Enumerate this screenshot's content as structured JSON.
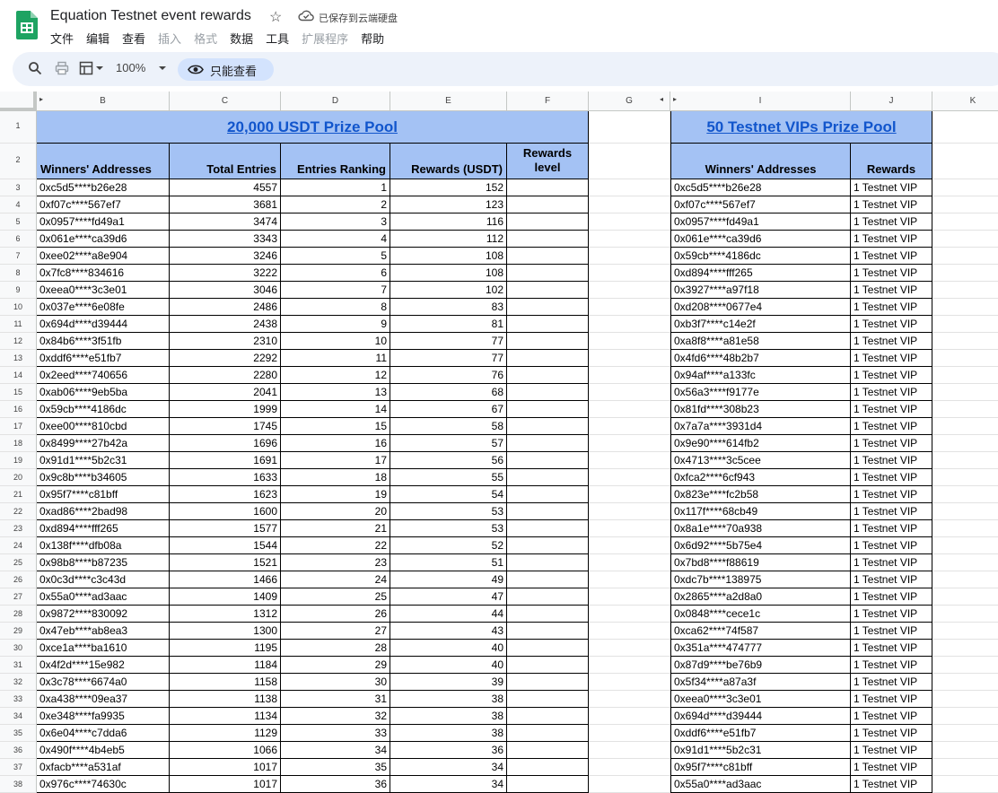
{
  "app": {
    "doc_title": "Equation Testnet event rewards",
    "saved_status": "已保存到云端硬盘",
    "menu": [
      "文件",
      "编辑",
      "查看",
      "插入",
      "格式",
      "数据",
      "工具",
      "扩展程序",
      "帮助"
    ],
    "menu_disabled": [
      false,
      false,
      false,
      true,
      true,
      false,
      false,
      true,
      false
    ],
    "zoom": "100%",
    "view_only_label": "只能查看",
    "accent_color": "#1ea362",
    "header_fill_color": "#a4c2f4",
    "link_color": "#1155cc"
  },
  "columns": [
    "B",
    "C",
    "D",
    "E",
    "F",
    "G",
    "I",
    "J",
    "K"
  ],
  "rows": [
    "1",
    "2",
    "3",
    "4",
    "5",
    "6",
    "7",
    "8",
    "9",
    "10",
    "11",
    "12",
    "13",
    "14",
    "15",
    "16",
    "17",
    "18",
    "19",
    "20",
    "21",
    "22",
    "23",
    "24",
    "25",
    "26",
    "27",
    "28",
    "29",
    "30",
    "31",
    "32",
    "33",
    "34",
    "35",
    "36",
    "37",
    "38"
  ],
  "table1": {
    "title": "20,000 USDT Prize Pool",
    "headers": [
      "Winners' Addresses",
      "Total Entries",
      "Entries Ranking",
      "Rewards (USDT)",
      "Rewards level"
    ],
    "rows": [
      [
        "0xc5d5****b26e28",
        "4557",
        "1",
        "152"
      ],
      [
        "0xf07c****567ef7",
        "3681",
        "2",
        "123"
      ],
      [
        "0x0957****fd49a1",
        "3474",
        "3",
        "116"
      ],
      [
        "0x061e****ca39d6",
        "3343",
        "4",
        "112"
      ],
      [
        "0xee02****a8e904",
        "3246",
        "5",
        "108"
      ],
      [
        "0x7fc8****834616",
        "3222",
        "6",
        "108"
      ],
      [
        "0xeea0****3c3e01",
        "3046",
        "7",
        "102"
      ],
      [
        "0x037e****6e08fe",
        "2486",
        "8",
        "83"
      ],
      [
        "0x694d****d39444",
        "2438",
        "9",
        "81"
      ],
      [
        "0x84b6****3f51fb",
        "2310",
        "10",
        "77"
      ],
      [
        "0xddf6****e51fb7",
        "2292",
        "11",
        "77"
      ],
      [
        "0x2eed****740656",
        "2280",
        "12",
        "76"
      ],
      [
        "0xab06****9eb5ba",
        "2041",
        "13",
        "68"
      ],
      [
        "0x59cb****4186dc",
        "1999",
        "14",
        "67"
      ],
      [
        "0xee00****810cbd",
        "1745",
        "15",
        "58"
      ],
      [
        "0x8499****27b42a",
        "1696",
        "16",
        "57"
      ],
      [
        "0x91d1****5b2c31",
        "1691",
        "17",
        "56"
      ],
      [
        "0x9c8b****b34605",
        "1633",
        "18",
        "55"
      ],
      [
        "0x95f7****c81bff",
        "1623",
        "19",
        "54"
      ],
      [
        "0xad86****2bad98",
        "1600",
        "20",
        "53"
      ],
      [
        "0xd894****fff265",
        "1577",
        "21",
        "53"
      ],
      [
        "0x138f****dfb08a",
        "1544",
        "22",
        "52"
      ],
      [
        "0x98b8****b87235",
        "1521",
        "23",
        "51"
      ],
      [
        "0x0c3d****c3c43d",
        "1466",
        "24",
        "49"
      ],
      [
        "0x55a0****ad3aac",
        "1409",
        "25",
        "47"
      ],
      [
        "0x9872****830092",
        "1312",
        "26",
        "44"
      ],
      [
        "0x47eb****ab8ea3",
        "1300",
        "27",
        "43"
      ],
      [
        "0xce1a****ba1610",
        "1195",
        "28",
        "40"
      ],
      [
        "0x4f2d****15e982",
        "1184",
        "29",
        "40"
      ],
      [
        "0x3c78****6674a0",
        "1158",
        "30",
        "39"
      ],
      [
        "0xa438****09ea37",
        "1138",
        "31",
        "38"
      ],
      [
        "0xe348****fa9935",
        "1134",
        "32",
        "38"
      ],
      [
        "0x6e04****c7dda6",
        "1129",
        "33",
        "38"
      ],
      [
        "0x490f****4b4eb5",
        "1066",
        "34",
        "36"
      ],
      [
        "0xfacb****a531af",
        "1017",
        "35",
        "34"
      ],
      [
        "0x976c****74630c",
        "1017",
        "36",
        "34"
      ]
    ]
  },
  "table2": {
    "title": "50 Testnet VIPs Prize Pool",
    "headers": [
      "Winners' Addresses",
      "Rewards"
    ],
    "rows": [
      [
        "0xc5d5****b26e28",
        "1 Testnet VIP"
      ],
      [
        "0xf07c****567ef7",
        "1 Testnet VIP"
      ],
      [
        "0x0957****fd49a1",
        "1 Testnet VIP"
      ],
      [
        "0x061e****ca39d6",
        "1 Testnet VIP"
      ],
      [
        "0x59cb****4186dc",
        "1 Testnet VIP"
      ],
      [
        "0xd894****fff265",
        "1 Testnet VIP"
      ],
      [
        "0x3927****a97f18",
        "1 Testnet VIP"
      ],
      [
        "0xd208****0677e4",
        "1 Testnet VIP"
      ],
      [
        "0xb3f7****c14e2f",
        "1 Testnet VIP"
      ],
      [
        "0xa8f8****a81e58",
        "1 Testnet VIP"
      ],
      [
        "0x4fd6****48b2b7",
        "1 Testnet VIP"
      ],
      [
        "0x94af****a133fc",
        "1 Testnet VIP"
      ],
      [
        "0x56a3****f9177e",
        "1 Testnet VIP"
      ],
      [
        "0x81fd****308b23",
        "1 Testnet VIP"
      ],
      [
        "0x7a7a****3931d4",
        "1 Testnet VIP"
      ],
      [
        "0x9e90****614fb2",
        "1 Testnet VIP"
      ],
      [
        "0x4713****3c5cee",
        "1 Testnet VIP"
      ],
      [
        "0xfca2****6cf943",
        "1 Testnet VIP"
      ],
      [
        "0x823e****fc2b58",
        "1 Testnet VIP"
      ],
      [
        "0x117f****68cb49",
        "1 Testnet VIP"
      ],
      [
        "0x8a1e****70a938",
        "1 Testnet VIP"
      ],
      [
        "0x6d92****5b75e4",
        "1 Testnet VIP"
      ],
      [
        "0x7bd8****f88619",
        "1 Testnet VIP"
      ],
      [
        "0xdc7b****138975",
        "1 Testnet VIP"
      ],
      [
        "0x2865****a2d8a0",
        "1 Testnet VIP"
      ],
      [
        "0x0848****cece1c",
        "1 Testnet VIP"
      ],
      [
        "0xca62****74f587",
        "1 Testnet VIP"
      ],
      [
        "0x351a****474777",
        "1 Testnet VIP"
      ],
      [
        "0x87d9****be76b9",
        "1 Testnet VIP"
      ],
      [
        "0x5f34****a87a3f",
        "1 Testnet VIP"
      ],
      [
        "0xeea0****3c3e01",
        "1 Testnet VIP"
      ],
      [
        "0x694d****d39444",
        "1 Testnet VIP"
      ],
      [
        "0xddf6****e51fb7",
        "1 Testnet VIP"
      ],
      [
        "0x91d1****5b2c31",
        "1 Testnet VIP"
      ],
      [
        "0x95f7****c81bff",
        "1 Testnet VIP"
      ],
      [
        "0x55a0****ad3aac",
        "1 Testnet VIP"
      ]
    ]
  }
}
